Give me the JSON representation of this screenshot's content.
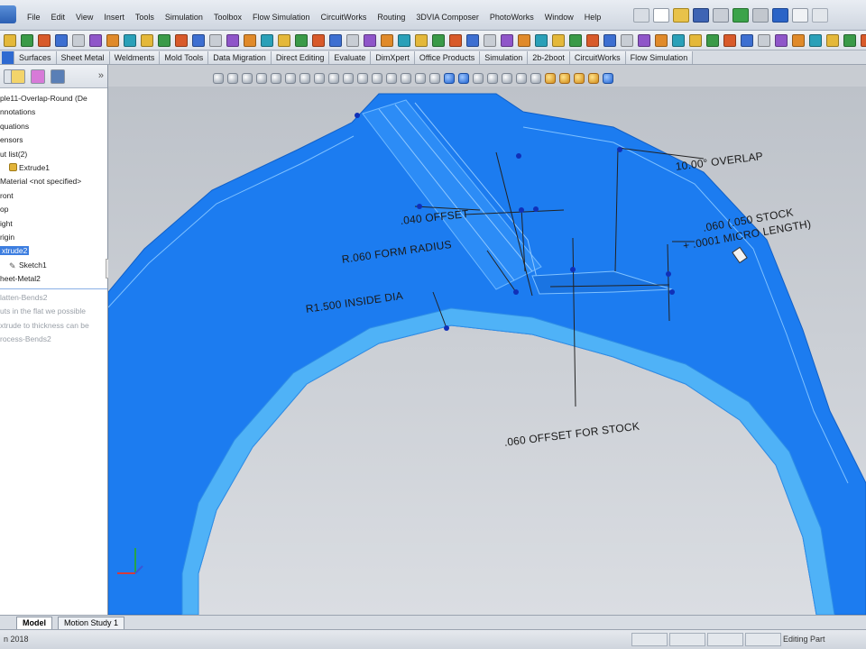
{
  "menubar": {
    "items": [
      "File",
      "Edit",
      "View",
      "Insert",
      "Tools",
      "Simulation",
      "Toolbox",
      "Flow Simulation",
      "CircuitWorks",
      "Routing",
      "3DVIA Composer",
      "PhotoWorks",
      "Window",
      "Help"
    ]
  },
  "tabs": [
    "Surfaces",
    "Sheet Metal",
    "Weldments",
    "Mold Tools",
    "Data Migration",
    "Direct Editing",
    "Evaluate",
    "DimXpert",
    "Office Products",
    "Simulation",
    "2b-2boot",
    "CircuitWorks",
    "Flow Simulation"
  ],
  "tree": {
    "items": [
      {
        "label": "ple11-Overlap-Round  (De",
        "kind": "root"
      },
      {
        "label": "nnotations",
        "kind": "folder"
      },
      {
        "label": "quations",
        "kind": "folder"
      },
      {
        "label": "ensors",
        "kind": "folder"
      },
      {
        "label": "ut list(2)",
        "kind": "folder"
      },
      {
        "label": "Extrude1",
        "kind": "feature"
      },
      {
        "label": "Material <not specified>",
        "kind": "material"
      },
      {
        "label": "ront",
        "kind": "plane"
      },
      {
        "label": "op",
        "kind": "plane"
      },
      {
        "label": "ight",
        "kind": "plane"
      },
      {
        "label": "rigin",
        "kind": "origin"
      },
      {
        "label": "xtrude2",
        "kind": "selected"
      },
      {
        "label": "Sketch1",
        "kind": "sketch"
      },
      {
        "label": "heet-Metal2",
        "kind": "feature"
      },
      {
        "label": "latten-Bends2",
        "kind": "grey"
      },
      {
        "label": "uts in the flat we possible",
        "kind": "grey"
      },
      {
        "label": "xtrude to thickness can be",
        "kind": "grey"
      },
      {
        "label": "rocess-Bends2",
        "kind": "grey"
      }
    ]
  },
  "annotations": {
    "overlap": "10.00° OVERLAP",
    "offset": ".040 OFFSET",
    "form_radius": "R.060 FORM RADIUS",
    "stock_line1": ".060 (.050 STOCK",
    "stock_line2": "+ .0001 MICRO LENGTH)",
    "inside_dia": "R1.500 INSIDE DIA",
    "offset_stock": ".060 OFFSET FOR STOCK"
  },
  "bottom_tabs": {
    "model": "Model",
    "motion": "Motion Study 1"
  },
  "status": {
    "left": "n 2018",
    "right": "Editing Part"
  },
  "colors": {
    "part_blue": "#1c7cf0",
    "part_light": "#4fb2f7",
    "background": "#c8ccd2"
  }
}
